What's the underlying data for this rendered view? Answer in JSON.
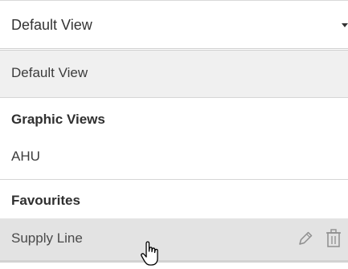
{
  "select": {
    "value": "Default View",
    "caret_icon": "caret-down-icon"
  },
  "dropdown": {
    "default_option": "Default View",
    "graphic_views": {
      "title": "Graphic Views",
      "items": [
        "AHU"
      ]
    },
    "favourites": {
      "title": "Favourites",
      "items": [
        {
          "label": "Supply Line",
          "edit_icon": "pencil-icon",
          "delete_icon": "trash-icon"
        }
      ]
    }
  },
  "colors": {
    "hover_bg": "#e3e3e3",
    "selected_bg": "#f0f0f0",
    "icon_gray": "#8e8e8e"
  },
  "cursor": "hand-pointer-icon"
}
